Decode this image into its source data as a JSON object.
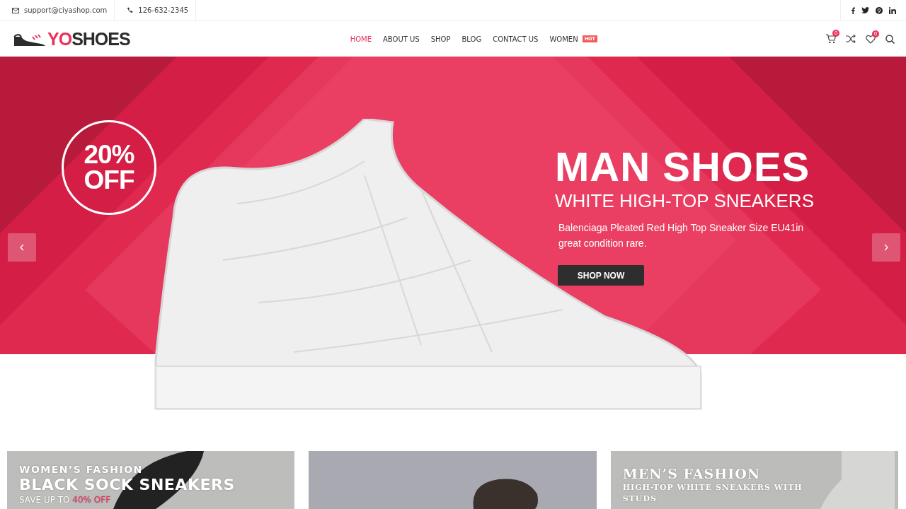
{
  "topbar": {
    "email": "support@ciyashop.com",
    "phone": "126-632-2345"
  },
  "header": {
    "logo": {
      "accent": "YO",
      "rest": "SHOES"
    },
    "nav": [
      {
        "label": "HOME",
        "selected": true
      },
      {
        "label": "ABOUT US",
        "selected": false
      },
      {
        "label": "SHOP",
        "selected": false
      },
      {
        "label": "BLOG",
        "selected": false
      },
      {
        "label": "CONTACT US",
        "selected": false
      },
      {
        "label": "WOMEN",
        "selected": false,
        "badge": "HOT"
      }
    ],
    "cart_count": "0",
    "wishlist_count": "0"
  },
  "hero": {
    "badge": {
      "value": "20%",
      "label": "OFF"
    },
    "title": "MAN SHOES",
    "subtitle": "WHITE HIGH-TOP SNEAKERS",
    "description": "Balenciaga Pleated Red High Top Sneaker Size EU41in great condition rare.",
    "button": "SHOP NOW"
  },
  "promos": [
    {
      "kind": "women",
      "eyebrow": "WOMEN’S FASHION",
      "title": "BLACK SOCK SNEAKERS",
      "offer": "SAVE UP TO ",
      "offer_highlight": "40% OFF"
    },
    {
      "kind": "photo"
    },
    {
      "kind": "men",
      "eyebrow": "MEN’S FASHION",
      "title": "HIGH-TOP WHITE SNEAKERS WITH STUDS"
    }
  ]
}
